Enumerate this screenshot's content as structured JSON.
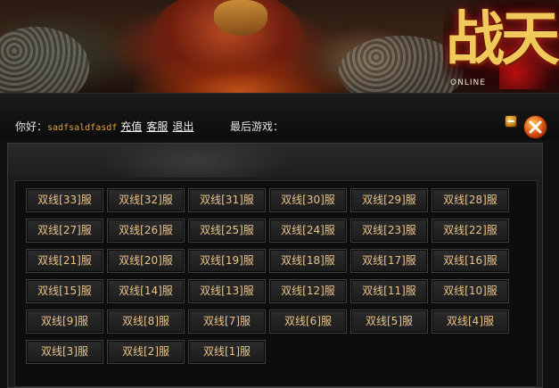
{
  "header": {
    "logo_text": "战天",
    "logo_subtitle": "ONLINE"
  },
  "toolbar": {
    "greeting_label": "你好：",
    "username": "sadfsaldfasdf",
    "recharge_link": "充值",
    "service_link": "客服",
    "logout_link": "退出",
    "last_game_label": "最后游戏："
  },
  "icons": {
    "minimize": "minimize-icon",
    "close": "close-icon"
  },
  "colors": {
    "server_text": "#ebc38a",
    "username": "#e6a23a",
    "close_button": "#e0601a"
  },
  "servers": [
    "双线[33]服",
    "双线[32]服",
    "双线[31]服",
    "双线[30]服",
    "双线[29]服",
    "双线[28]服",
    "双线[27]服",
    "双线[26]服",
    "双线[25]服",
    "双线[24]服",
    "双线[23]服",
    "双线[22]服",
    "双线[21]服",
    "双线[20]服",
    "双线[19]服",
    "双线[18]服",
    "双线[17]服",
    "双线[16]服",
    "双线[15]服",
    "双线[14]服",
    "双线[13]服",
    "双线[12]服",
    "双线[11]服",
    "双线[10]服",
    "双线[9]服",
    "双线[8]服",
    "双线[7]服",
    "双线[6]服",
    "双线[5]服",
    "双线[4]服",
    "双线[3]服",
    "双线[2]服",
    "双线[1]服"
  ]
}
